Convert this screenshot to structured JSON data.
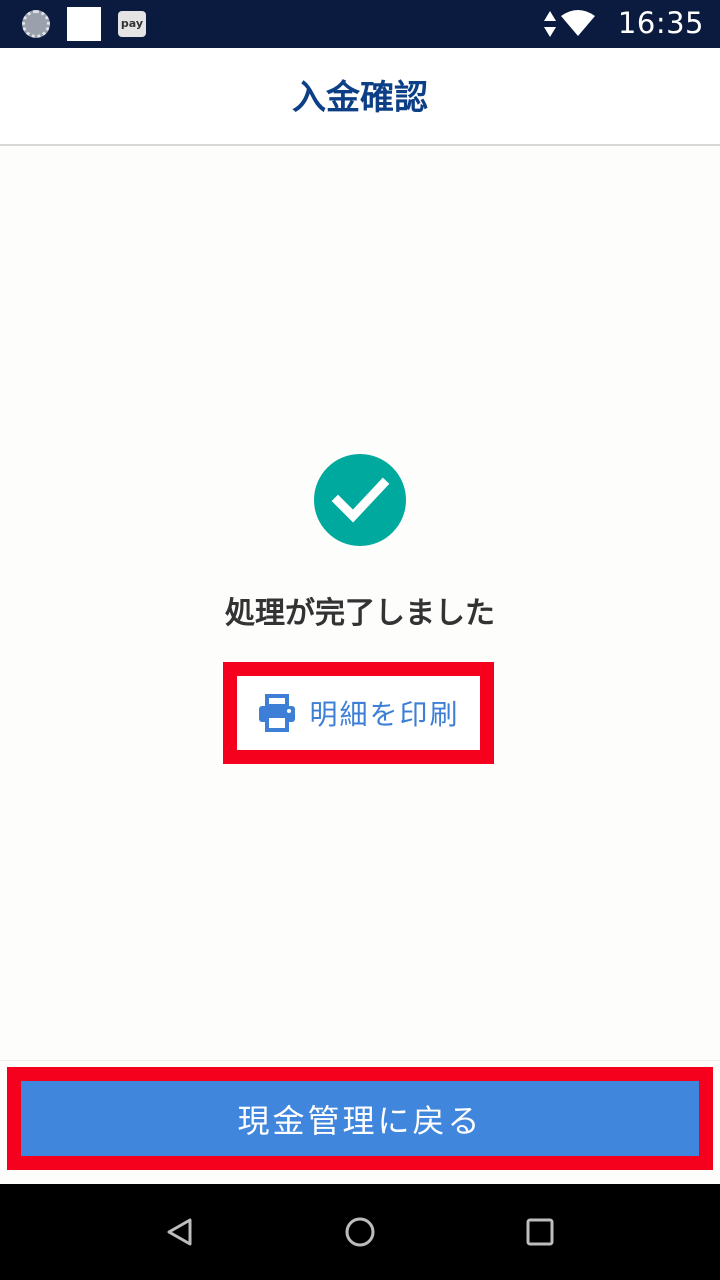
{
  "status_bar": {
    "time": "16:35",
    "pay_label": "pay",
    "icons": [
      "loading-icon",
      "white-square-icon",
      "pay-icon",
      "data-arrows-icon",
      "wifi-icon"
    ]
  },
  "header": {
    "title": "入金確認"
  },
  "main": {
    "status_icon": "check-circle-icon",
    "status_color": "#00a99d",
    "message": "処理が完了しました",
    "print_button": {
      "icon": "printer-icon",
      "label": "明細を印刷"
    }
  },
  "footer": {
    "back_button_label": "現金管理に戻る",
    "button_color": "#3f86dc"
  },
  "navigation_bar": {
    "icons": [
      "back-triangle-icon",
      "home-circle-icon",
      "recent-square-icon"
    ]
  },
  "colors": {
    "header_title": "#0d3f86",
    "highlight_border": "#f5001d",
    "link_blue": "#3d7fd6"
  }
}
